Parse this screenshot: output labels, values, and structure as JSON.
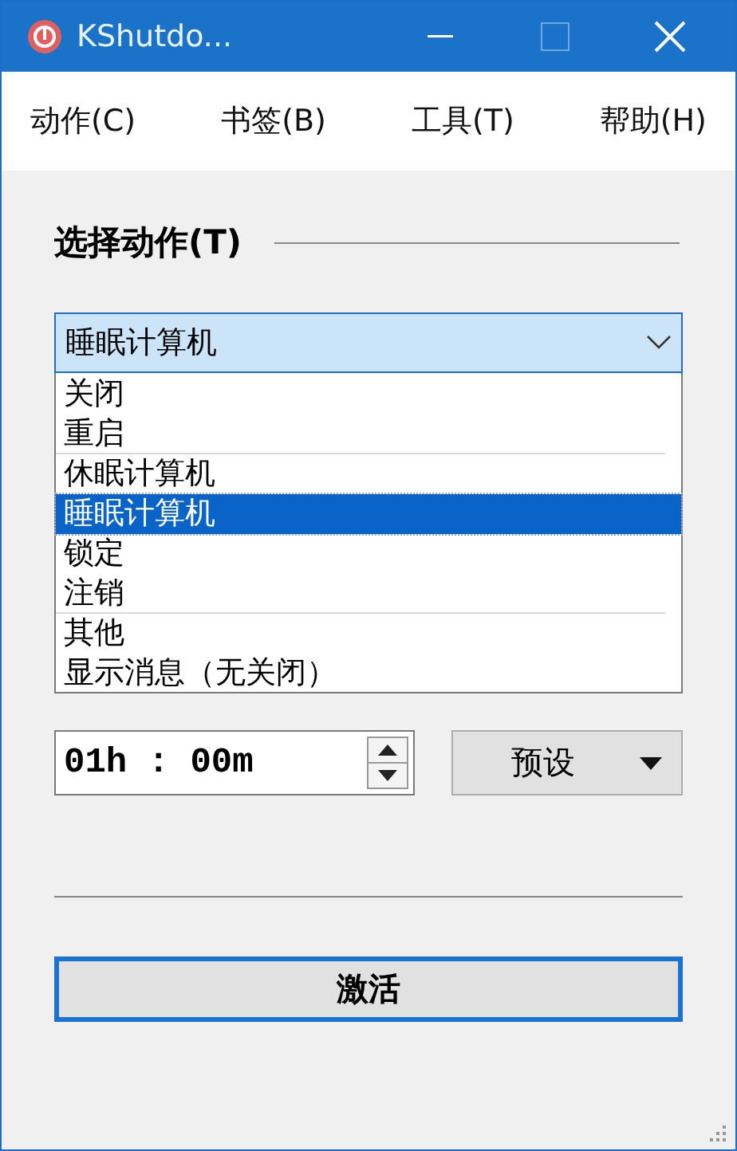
{
  "window": {
    "title": "KShutdo..."
  },
  "menu": [
    {
      "label": "动作(C)"
    },
    {
      "label": "书签(B)"
    },
    {
      "label": "工具(T)"
    },
    {
      "label": "帮助(H)"
    }
  ],
  "section_title": "选择动作(T)",
  "action_combo": {
    "value": "睡眠计算机",
    "expanded": true
  },
  "action_list": [
    {
      "label": "关闭",
      "selected": false,
      "divider_after": false
    },
    {
      "label": "重启",
      "selected": false,
      "divider_after": true
    },
    {
      "label": "休眠计算机",
      "selected": false,
      "divider_after": false
    },
    {
      "label": "睡眠计算机",
      "selected": true,
      "divider_after": false
    },
    {
      "label": "锁定",
      "selected": false,
      "divider_after": false
    },
    {
      "label": "注销",
      "selected": false,
      "divider_after": true
    },
    {
      "label": "其他",
      "selected": false,
      "divider_after": false
    },
    {
      "label": "显示消息（无关闭）",
      "selected": false,
      "divider_after": false
    }
  ],
  "time_field": {
    "value": "01h : 00m"
  },
  "preset_button": {
    "label": "预设"
  },
  "activate_button": {
    "label": "激活",
    "focused": true
  }
}
